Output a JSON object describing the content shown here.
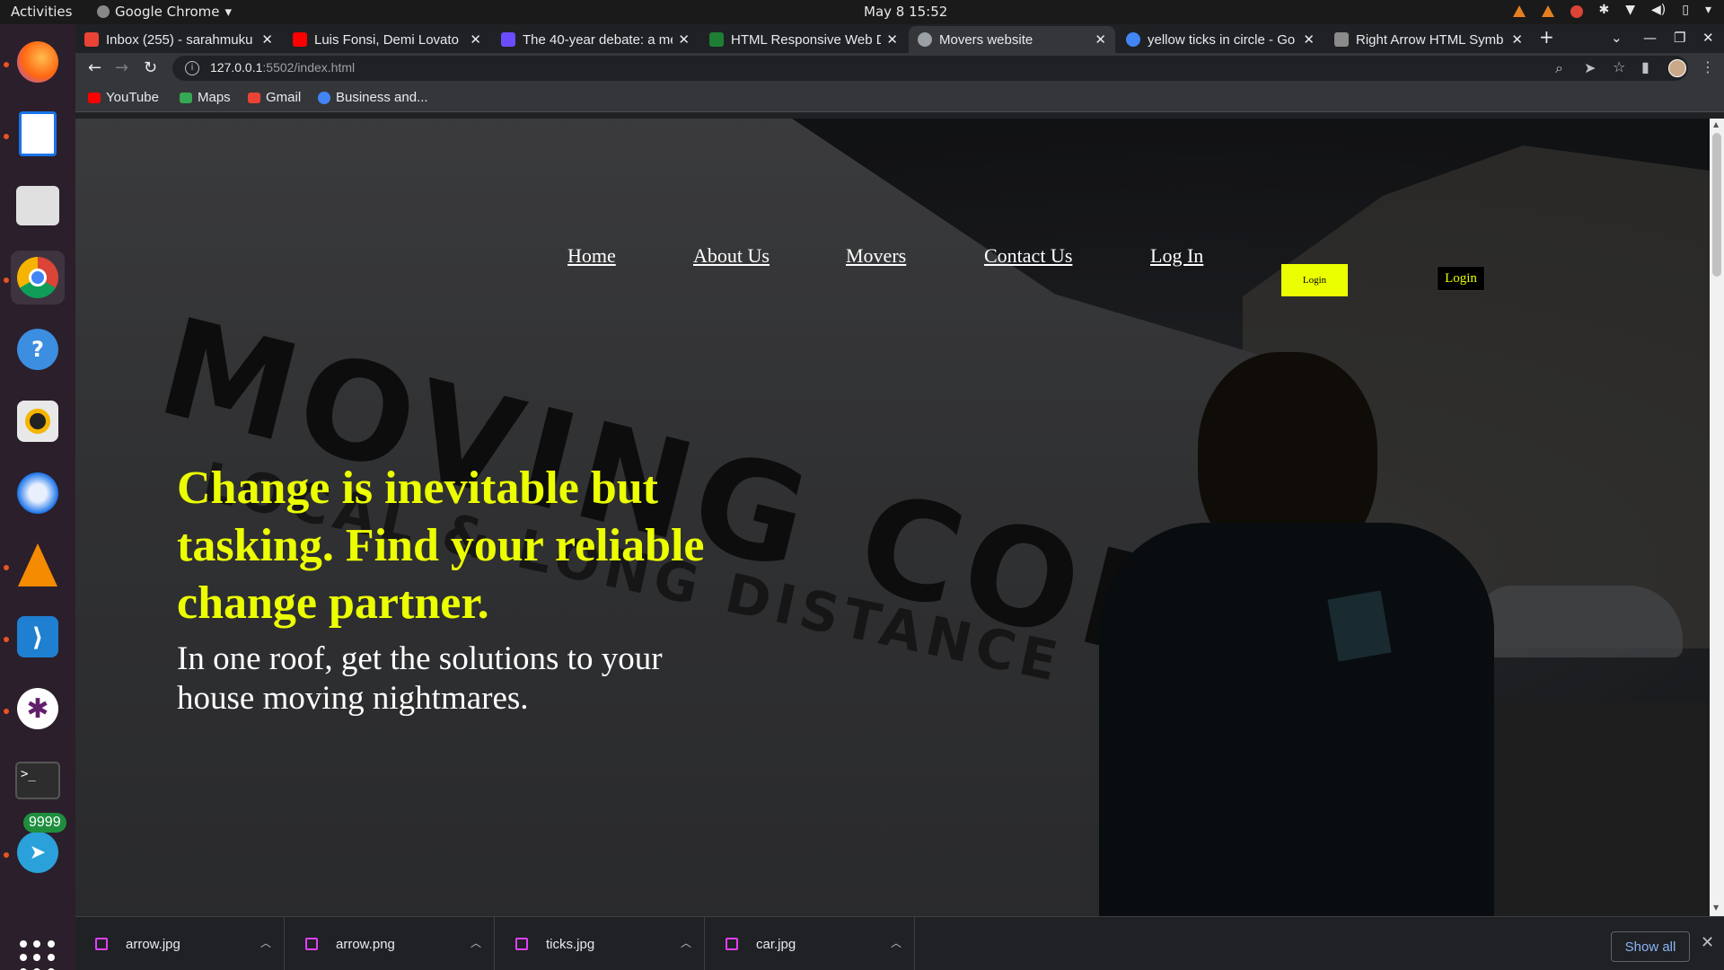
{
  "system": {
    "activities": "Activities",
    "app_name": "Google Chrome",
    "clock": "May 8  15:52"
  },
  "dock": {
    "badge_count": "9999",
    "items": [
      "Firefox",
      "LibreOffice Writer",
      "Files",
      "Google Chrome",
      "Help",
      "Rhythmbox",
      "Thunderbird",
      "VLC",
      "Visual Studio Code",
      "Slack",
      "Terminal",
      "Telegram"
    ]
  },
  "tabs": [
    {
      "title": "Inbox (255) - sarahmuku",
      "fav_color": "#ea4335"
    },
    {
      "title": "Luis Fonsi, Demi Lovato",
      "fav_color": "#ff0000"
    },
    {
      "title": "The 40-year debate: a me",
      "fav_color": "#6b4cff"
    },
    {
      "title": "HTML Responsive Web D",
      "fav_color": "#1e7e34"
    },
    {
      "title": "Movers website",
      "fav_color": "#9aa0a6",
      "active": true
    },
    {
      "title": "yellow ticks in circle - Go",
      "fav_color": "#4285f4"
    },
    {
      "title": "Right Arrow HTML Symb",
      "fav_color": "#8a8a8a"
    }
  ],
  "toolbar": {
    "url_host": "127.0.0.1",
    "url_path": ":5502/index.html"
  },
  "bookmarks": [
    {
      "label": "YouTube",
      "color": "#ff0000"
    },
    {
      "label": "Maps",
      "color": "#34a853"
    },
    {
      "label": "Gmail",
      "color": "#ea4335"
    },
    {
      "label": "Business and...",
      "color": "#4285f4"
    }
  ],
  "page": {
    "nav": [
      "Home",
      "About Us",
      "Movers",
      "Contact Us",
      "Log In"
    ],
    "login_yellow": "Login",
    "login_black": "Login",
    "headline": "Change is inevitable but tasking. Find your reliable change partner.",
    "subline": "In one roof, get the solutions to your house moving nightmares.",
    "van_text_big": "MOVING COMPANY",
    "van_text_small": "LOCAL & LONG DISTANCE",
    "accent": "#ecff00"
  },
  "downloads": {
    "files": [
      "arrow.jpg",
      "arrow.png",
      "ticks.jpg",
      "car.jpg"
    ],
    "show_all": "Show all"
  }
}
